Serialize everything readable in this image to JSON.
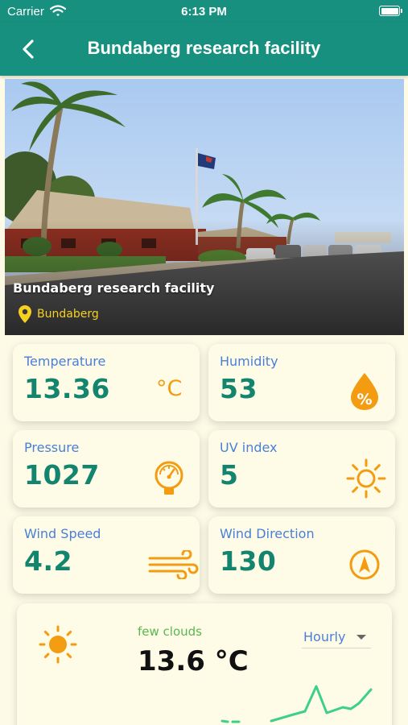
{
  "status_bar": {
    "carrier": "Carrier",
    "time": "6:13 PM"
  },
  "nav": {
    "title": "Bundaberg research facility"
  },
  "hero": {
    "title": "Bundaberg research facility",
    "location": "Bundaberg"
  },
  "metrics": {
    "temperature": {
      "label": "Temperature",
      "value": "13.36",
      "unit": "°C"
    },
    "humidity": {
      "label": "Humidity",
      "value": "53",
      "icon": "humidity-percent-drop-icon"
    },
    "pressure": {
      "label": "Pressure",
      "value": "1027",
      "icon": "gauge-icon"
    },
    "uv": {
      "label": "UV index",
      "value": "5",
      "icon": "sun-icon"
    },
    "wind_speed": {
      "label": "Wind Speed",
      "value": "4.2",
      "icon": "wind-icon"
    },
    "wind_direction": {
      "label": "Wind Direction",
      "value": "130",
      "icon": "compass-icon"
    }
  },
  "forecast": {
    "description": "few clouds",
    "temperature": "13.6 °C",
    "interval": "Hourly",
    "icon": "sun-icon"
  },
  "colors": {
    "header": "#17907f",
    "accent_orange": "#f39c12",
    "value_green": "#13856f",
    "label_blue": "#4a7fd6",
    "card_bg": "#fefce6"
  }
}
